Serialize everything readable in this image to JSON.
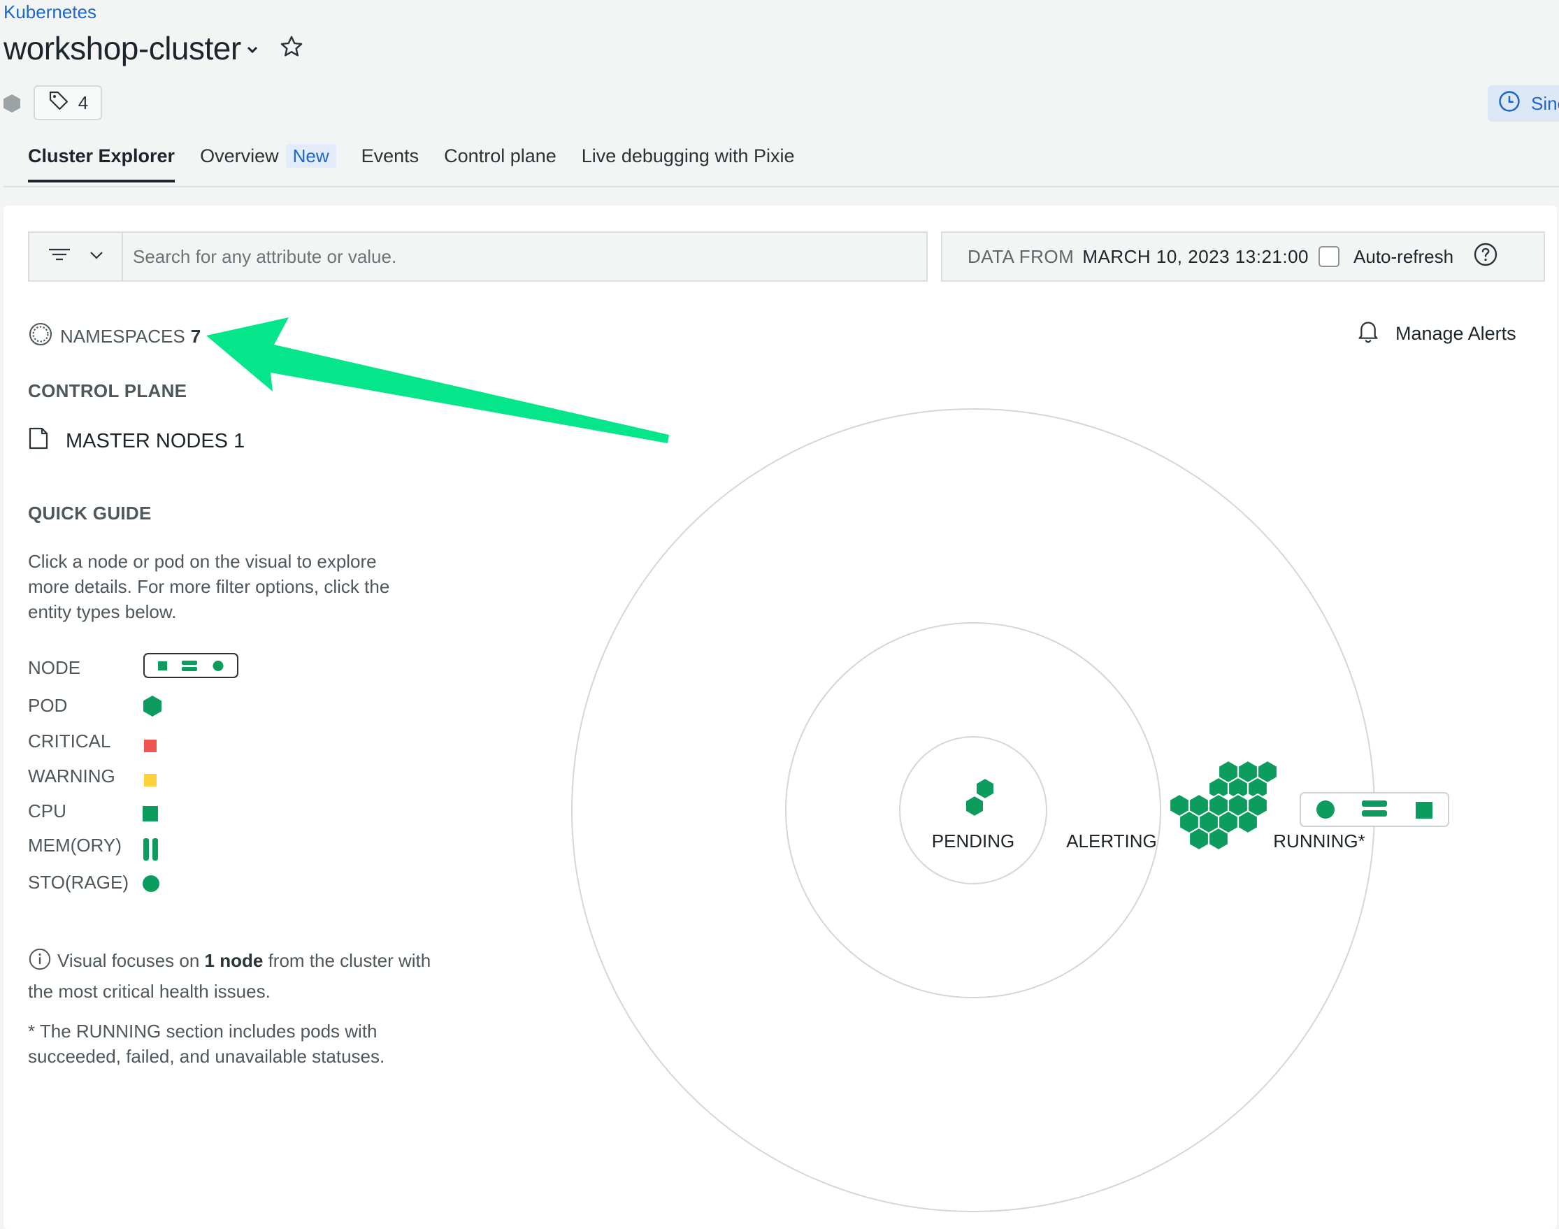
{
  "header": {
    "breadcrumb": "Kubernetes",
    "title": "workshop-cluster",
    "tag_count": "4",
    "since_label": "Since"
  },
  "tabs": [
    {
      "label": "Cluster Explorer",
      "active": true
    },
    {
      "label": "Overview",
      "badge": "New"
    },
    {
      "label": "Events"
    },
    {
      "label": "Control plane"
    },
    {
      "label": "Live debugging with Pixie"
    }
  ],
  "toolbar": {
    "search_placeholder": "Search for any attribute or value.",
    "data_from_label": "DATA FROM",
    "data_from_value": "MARCH 10, 2023 13:21:00",
    "auto_refresh_label": "Auto-refresh",
    "auto_refresh_checked": false
  },
  "sidebar": {
    "namespaces_label": "NAMESPACES",
    "namespaces_count": "7",
    "manage_alerts": "Manage Alerts",
    "control_plane_heading": "CONTROL PLANE",
    "master_nodes_label": "MASTER NODES",
    "master_nodes_count": "1",
    "quick_guide_heading": "QUICK GUIDE",
    "quick_guide_text": "Click a node or pod on the visual to explore more details. For more filter options, click the entity types below.",
    "legend": [
      {
        "label": "NODE",
        "icon": "node-icon"
      },
      {
        "label": "POD",
        "icon": "pod-hexagon-icon"
      },
      {
        "label": "CRITICAL",
        "icon": "critical-square-icon"
      },
      {
        "label": "WARNING",
        "icon": "warning-square-icon"
      },
      {
        "label": "CPU",
        "icon": "cpu-square-icon"
      },
      {
        "label": "MEM(ORY)",
        "icon": "memory-bars-icon"
      },
      {
        "label": "STO(RAGE)",
        "icon": "storage-circle-icon"
      }
    ],
    "note_prefix": "Visual focuses on ",
    "note_bold": "1 node",
    "note_suffix": " from the cluster with the most critical health issues.",
    "running_note": "* The RUNNING section includes pods with succeeded, failed, and unavailable statuses."
  },
  "visual": {
    "labels": {
      "pending": "PENDING",
      "alerting": "ALERTING",
      "running": "RUNNING*"
    },
    "pending_pods": 2,
    "running_pods": 17
  },
  "colors": {
    "green": "#0c9c5e",
    "critical": "#ef5350",
    "warning": "#fdd13a",
    "link_blue": "#1d67c9",
    "annotation_arrow": "#05e58a"
  }
}
